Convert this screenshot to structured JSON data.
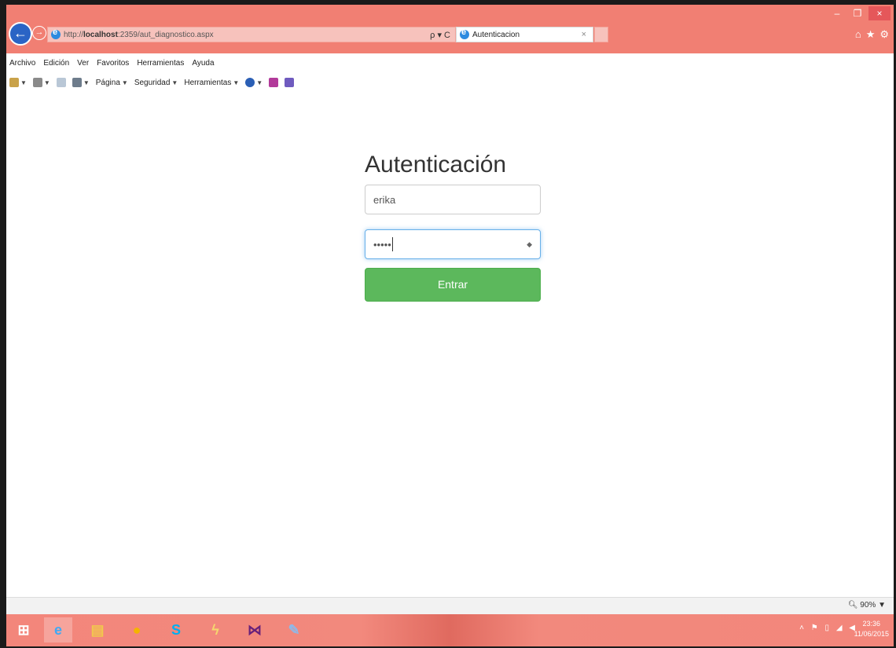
{
  "browser": {
    "url_prefix": "http://",
    "url_host": "localhost",
    "url_path": ":2359/aut_diagnostico.aspx",
    "addr_tools": "ρ ▾ C",
    "tab_title": "Autenticacion",
    "tab_close": "×",
    "window_controls": {
      "minimize": "–",
      "restore": "❐",
      "close": "×"
    },
    "right_icons": {
      "home": "⌂",
      "favorites": "★",
      "settings": "⚙"
    },
    "menu": [
      "Archivo",
      "Edición",
      "Ver",
      "Favoritos",
      "Herramientas",
      "Ayuda"
    ],
    "commands": {
      "page": "Página",
      "security": "Seguridad",
      "tools": "Herramientas"
    },
    "zoom": "90%"
  },
  "login": {
    "title": "Autenticación",
    "username_value": "erika",
    "password_value": "•••••",
    "submit_label": "Entrar"
  },
  "taskbar": {
    "time": "23:36",
    "date": "11/06/2015"
  },
  "colors": {
    "chrome_accent": "#f17f73",
    "button_green": "#5cb85c",
    "focus_blue": "#66afe9"
  }
}
